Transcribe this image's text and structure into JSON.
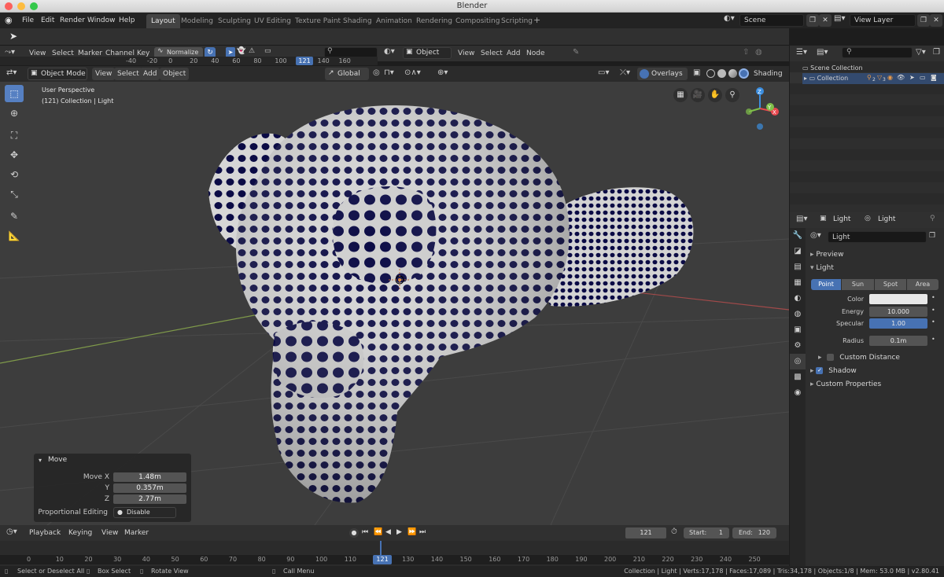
{
  "window": {
    "title": "Blender"
  },
  "menu": {
    "items": [
      "File",
      "Edit",
      "Render",
      "Window",
      "Help"
    ]
  },
  "workspaces": {
    "active": "Layout",
    "tabs": [
      "Layout",
      "Modeling",
      "Sculpting",
      "UV Editing",
      "Texture Paint",
      "Shading",
      "Animation",
      "Rendering",
      "Compositing",
      "Scripting"
    ],
    "add": "+"
  },
  "scene": {
    "name": "Scene",
    "view_layer": "View Layer"
  },
  "dopesheet": {
    "menus": [
      "View",
      "Select",
      "Marker",
      "Channel",
      "Key"
    ],
    "normalize": "Normalize",
    "ruler": [
      "-40",
      "-20",
      "0",
      "20",
      "40",
      "60",
      "80",
      "100",
      "121",
      "140",
      "160"
    ],
    "current": "121"
  },
  "node_header": {
    "mode": "Object",
    "menus": [
      "View",
      "Select",
      "Add",
      "Node"
    ]
  },
  "viewport_header": {
    "mode": "Object Mode",
    "menus": [
      "View",
      "Select",
      "Add",
      "Object"
    ],
    "orientation": "Global",
    "overlays": "Overlays",
    "shading": "Shading"
  },
  "viewport": {
    "perspective": "User Perspective",
    "collection": "(121) Collection | Light"
  },
  "gizmo": {
    "x": "X",
    "y": "Y",
    "z": "Z",
    "colors": {
      "x": "#e8484f",
      "y": "#80c04a",
      "z": "#3b8ee0"
    }
  },
  "operator": {
    "title": "Move",
    "rows": [
      {
        "label": "Move X",
        "value": "1.48m"
      },
      {
        "label": "Y",
        "value": "0.357m"
      },
      {
        "label": "Z",
        "value": "2.77m"
      }
    ],
    "proportional_label": "Proportional Editing",
    "proportional_value": "Disable"
  },
  "timeline": {
    "menus": [
      "Playback",
      "Keying",
      "View",
      "Marker"
    ],
    "current_frame": "121",
    "start_label": "Start:",
    "start": "1",
    "end_label": "End:",
    "end": "120",
    "ruler": [
      "0",
      "10",
      "20",
      "30",
      "40",
      "50",
      "60",
      "70",
      "80",
      "90",
      "100",
      "110",
      "121",
      "130",
      "140",
      "150",
      "160",
      "170",
      "180",
      "190",
      "200",
      "210",
      "220",
      "230",
      "240",
      "250"
    ]
  },
  "status": {
    "left1": "Select or Deselect All",
    "left2": "Box Select",
    "left3": "Rotate View",
    "left4": "Call Menu",
    "right": "Collection | Light | Verts:17,178 | Faces:17,089 | Tris:34,178 | Objects:1/8 | Mem: 53.0 MB | v2.80.41"
  },
  "outliner": {
    "root": "Scene Collection",
    "child": "Collection",
    "counts": "2",
    "counts2": "3"
  },
  "properties": {
    "breadcrumb_object": "Light",
    "breadcrumb_data": "Light",
    "datablock": "Light",
    "panels": {
      "preview": "Preview",
      "light": "Light",
      "custom_distance": "Custom Distance",
      "shadow": "Shadow",
      "custom_props": "Custom Properties"
    },
    "types": [
      "Point",
      "Sun",
      "Spot",
      "Area"
    ],
    "active_type": "Point",
    "fields": [
      {
        "label": "Color",
        "value": ""
      },
      {
        "label": "Energy",
        "value": "10.000"
      },
      {
        "label": "Specular",
        "value": "1.00"
      },
      {
        "label": "Radius",
        "value": "0.1m"
      }
    ],
    "accent": "#4772b3"
  }
}
